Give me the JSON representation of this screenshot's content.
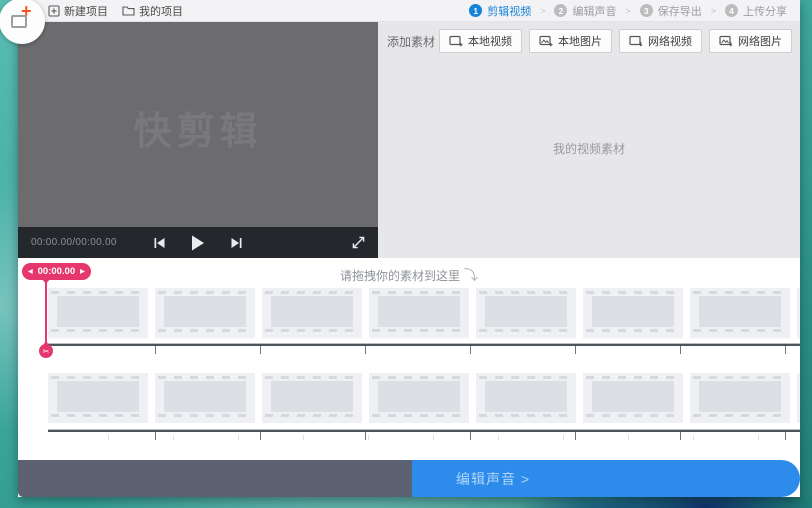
{
  "toolbar": {
    "new_project_label": "新建项目",
    "my_projects_label": "我的项目",
    "step_separator": ">",
    "steps": [
      {
        "num": "1",
        "label": "剪辑视频"
      },
      {
        "num": "2",
        "label": "编辑声音"
      },
      {
        "num": "3",
        "label": "保存导出"
      },
      {
        "num": "4",
        "label": "上传分享"
      }
    ]
  },
  "preview": {
    "watermark": "快剪辑",
    "time_display": "00:00.00/00:00.00"
  },
  "materials": {
    "title": "添加素材",
    "buttons": [
      {
        "label": "本地视频",
        "icon": "local-video-icon"
      },
      {
        "label": "本地图片",
        "icon": "local-image-icon"
      },
      {
        "label": "网络视频",
        "icon": "web-video-icon"
      },
      {
        "label": "网络图片",
        "icon": "web-image-icon"
      }
    ],
    "empty_text": "我的视频素材"
  },
  "timeline": {
    "playhead_time": "00:00.00",
    "prev_arrow": "◀",
    "next_arrow": "▶",
    "drop_hint": "请拖拽你的素材到这里",
    "drop_hint_arrow": "⤵",
    "scissors_glyph": "✂",
    "track_count": 2,
    "segments_per_track": 8,
    "tick_count": 7
  },
  "footer": {
    "edit_sound_label": "编辑声音 >"
  },
  "colors": {
    "accent_blue": "#1583d7",
    "accent_pink": "#e5376e",
    "footer_blue": "#2d8ceb",
    "footer_gray": "#5b6170"
  }
}
